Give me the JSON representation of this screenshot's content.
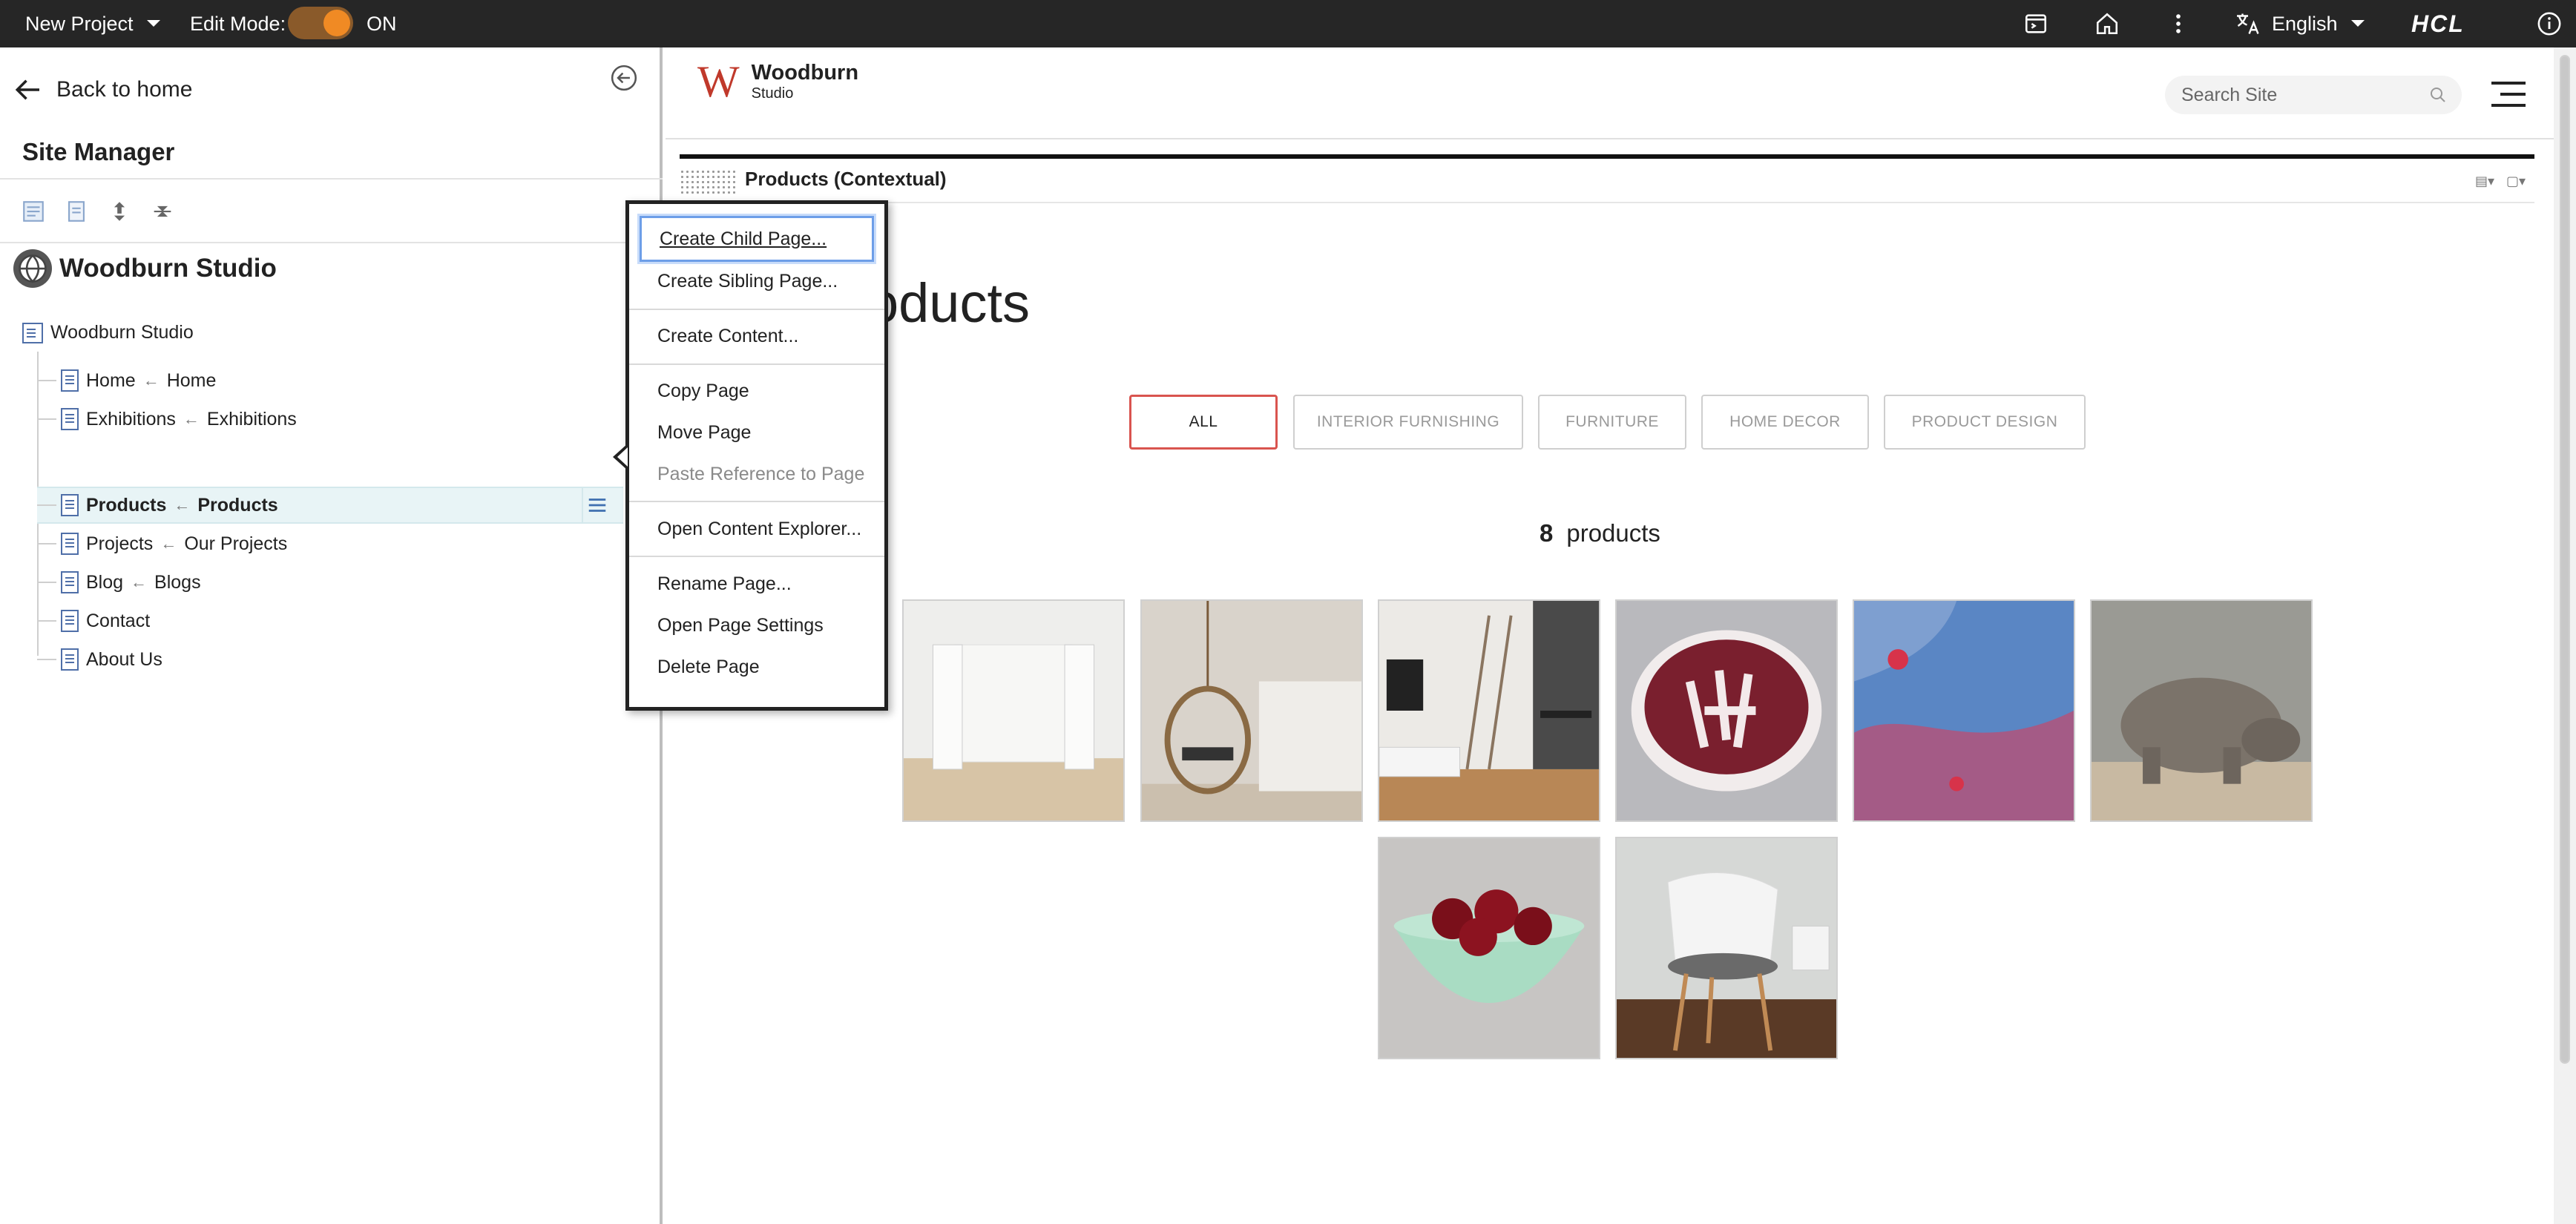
{
  "topbar": {
    "project": "New Project",
    "edit_mode_label": "Edit Mode:",
    "edit_mode_state": "ON",
    "language": "English",
    "brand": "HCL",
    "icons": [
      "preview-icon",
      "home-icon",
      "more-vert-icon",
      "translate-icon",
      "info-icon"
    ]
  },
  "left": {
    "back_label": "Back to home",
    "panel_title": "Site Manager",
    "library_name": "Woodburn Studio",
    "tree_root": "Woodburn Studio",
    "tree": [
      {
        "name": "Home",
        "title": "Home"
      },
      {
        "name": "Exhibitions",
        "title": "Exhibitions"
      },
      {
        "name": "Products",
        "title": "Products",
        "selected": true
      },
      {
        "name": "Projects",
        "title": "Our Projects"
      },
      {
        "name": "Blog",
        "title": "Blogs"
      },
      {
        "name": "Contact",
        "title": ""
      },
      {
        "name": "About Us",
        "title": ""
      }
    ]
  },
  "context_menu": {
    "items": [
      "Create Child Page...",
      "Create Sibling Page...",
      "Create Content...",
      "Copy Page",
      "Move Page",
      "Paste Reference to Page",
      "Open Content Explorer...",
      "Rename Page...",
      "Open Page Settings",
      "Delete Page"
    ],
    "disabled": [
      "Paste Reference to Page"
    ]
  },
  "site": {
    "brand_name": "Woodburn",
    "brand_sub": "Studio",
    "brand_letter": "W",
    "search_placeholder": "Search Site",
    "portlet_title": "Products (Contextual)",
    "page_heading_visible": "oducts",
    "filters": [
      "ALL",
      "INTERIOR FURNISHING",
      "FURNITURE",
      "HOME DECOR",
      "PRODUCT DESIGN"
    ],
    "active_filter": "ALL",
    "product_count": "8",
    "product_count_label": "products",
    "accent_color": "#d9544f"
  }
}
